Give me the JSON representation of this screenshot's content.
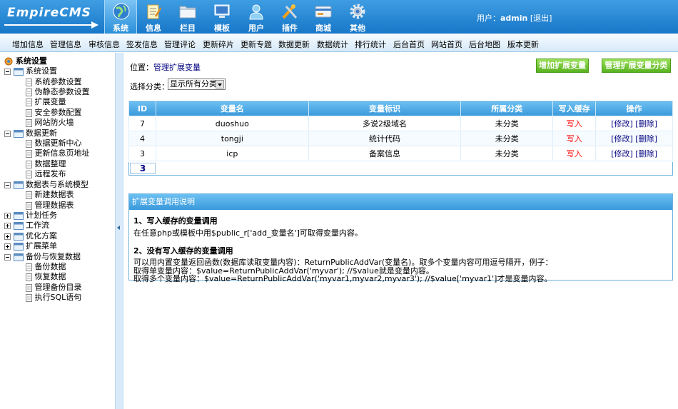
{
  "app": {
    "logo": "EmpireCMS",
    "user_label": "用户：",
    "username": "admin",
    "logout": "[退出]"
  },
  "nav": [
    {
      "label": "系统",
      "icon": "globe-icon"
    },
    {
      "label": "信息",
      "icon": "notepad-icon"
    },
    {
      "label": "栏目",
      "icon": "folder-icon"
    },
    {
      "label": "模板",
      "icon": "monitor-icon"
    },
    {
      "label": "用户",
      "icon": "user-icon"
    },
    {
      "label": "插件",
      "icon": "tools-icon"
    },
    {
      "label": "商城",
      "icon": "card-icon"
    },
    {
      "label": "其他",
      "icon": "gear-icon"
    }
  ],
  "submenu": [
    "增加信息",
    "管理信息",
    "审核信息",
    "签发信息",
    "管理评论",
    "更新碎片",
    "更新专题",
    "数据更新",
    "数据统计",
    "排行统计",
    "后台首页",
    "网站首页",
    "后台地图",
    "版本更新"
  ],
  "sidebar": {
    "root": "系统设置",
    "items": [
      {
        "label": "系统设置",
        "level": 0,
        "open": true
      },
      {
        "label": "系统参数设置",
        "level": 1
      },
      {
        "label": "伪静态参数设置",
        "level": 1
      },
      {
        "label": "扩展变量",
        "level": 1
      },
      {
        "label": "安全参数配置",
        "level": 1
      },
      {
        "label": "网站防火墙",
        "level": 1
      },
      {
        "label": "数据更新",
        "level": 0,
        "open": true
      },
      {
        "label": "数据更新中心",
        "level": 1
      },
      {
        "label": "更新信息页地址",
        "level": 1
      },
      {
        "label": "数据整理",
        "level": 1
      },
      {
        "label": "远程发布",
        "level": 1
      },
      {
        "label": "数据表与系统模型",
        "level": 0,
        "open": true
      },
      {
        "label": "新建数据表",
        "level": 1
      },
      {
        "label": "管理数据表",
        "level": 1
      },
      {
        "label": "计划任务",
        "level": 0,
        "open": false
      },
      {
        "label": "工作流",
        "level": 0,
        "open": false
      },
      {
        "label": "优化方案",
        "level": 0,
        "open": false
      },
      {
        "label": "扩展菜单",
        "level": 0,
        "open": false
      },
      {
        "label": "备份与恢复数据",
        "level": 0,
        "open": true
      },
      {
        "label": "备份数据",
        "level": 1
      },
      {
        "label": "恢复数据",
        "level": 1
      },
      {
        "label": "管理备份目录",
        "level": 1
      },
      {
        "label": "执行SQL语句",
        "level": 1
      }
    ]
  },
  "main": {
    "location_label": "位置：",
    "location_link": "管理扩展变量",
    "btn_add": "增加扩展变量",
    "btn_manage_class": "管理扩展变量分类",
    "category_label": "选择分类：",
    "category_value": "显示所有分类",
    "table": {
      "headers": [
        "ID",
        "变量名",
        "变量标识",
        "所属分类",
        "写入缓存",
        "操作"
      ],
      "rows": [
        {
          "id": "7",
          "name": "duoshuo",
          "ident": "多说2级域名",
          "class": "未分类",
          "cache": "写入",
          "edit": "[修改]",
          "del": "[删除]"
        },
        {
          "id": "4",
          "name": "tongji",
          "ident": "统计代码",
          "class": "未分类",
          "cache": "写入",
          "edit": "[修改]",
          "del": "[删除]"
        },
        {
          "id": "3",
          "name": "icp",
          "ident": "备案信息",
          "class": "未分类",
          "cache": "写入",
          "edit": "[修改]",
          "del": "[删除]"
        }
      ],
      "total": "3"
    },
    "help": {
      "title": "扩展变量调用说明",
      "h1": "1、写入缓存的变量调用",
      "p1": "在任意php或模板中用$public_r['add_变量名']可取得变量内容。",
      "h2": "2、没有写入缓存的变量调用",
      "p2": "可以用内置变量返回函数(数据库读取变量内容)：ReturnPublicAddVar(变量名)。取多个变量内容可用逗号隔开，例子：",
      "p3": "取得单变量内容：$value=ReturnPublicAddVar('myvar'); //$value就是变量内容。",
      "p4": "取得多个变量内容：$value=ReturnPublicAddVar('myvar1,myvar2,myvar3'); //$value['myvar1']才是变量内容。"
    }
  }
}
